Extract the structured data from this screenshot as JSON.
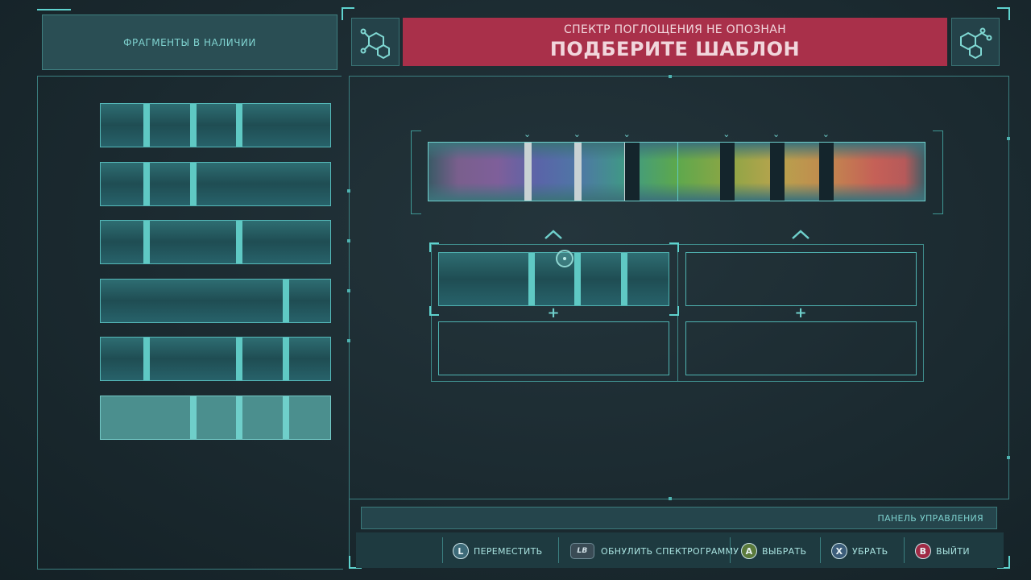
{
  "left_panel": {
    "title": "ФРАГМЕНТЫ В НАЛИЧИИ",
    "fragments": [
      {
        "bars": [
          0.2,
          0.4,
          0.6
        ],
        "selected": false
      },
      {
        "bars": [
          0.2,
          0.4
        ],
        "selected": false
      },
      {
        "bars": [
          0.2,
          0.6
        ],
        "selected": false
      },
      {
        "bars": [
          0.8
        ],
        "selected": false
      },
      {
        "bars": [
          0.2,
          0.6,
          0.8
        ],
        "selected": false
      },
      {
        "bars": [
          0.4,
          0.6,
          0.8
        ],
        "selected": true
      }
    ]
  },
  "header": {
    "status_subtitle": "СПЕКТР ПОГЛОЩЕНИЯ НЕ ОПОЗНАН",
    "status_title": "ПОДБЕРИТЕ ШАБЛОН",
    "left_icon": "molecule-icon",
    "right_icon": "molecule-icon",
    "banner_color": "#a9304a"
  },
  "spectrum": {
    "bands": [
      {
        "pos": 0.2,
        "kind": "light"
      },
      {
        "pos": 0.3,
        "kind": "light"
      },
      {
        "pos": 0.4,
        "kind": "light"
      },
      {
        "pos": 0.41,
        "kind": "dark"
      },
      {
        "pos": 0.6,
        "kind": "dark"
      },
      {
        "pos": 0.7,
        "kind": "dark"
      },
      {
        "pos": 0.8,
        "kind": "dark"
      }
    ],
    "markers": [
      0.2,
      0.3,
      0.4,
      0.6,
      0.7,
      0.8
    ]
  },
  "template": {
    "slots": [
      {
        "filled": true,
        "bars": [
          0.4,
          0.6,
          0.8
        ]
      },
      {
        "filled": false,
        "bars": []
      },
      {
        "filled": false,
        "bars": []
      },
      {
        "filled": false,
        "bars": []
      }
    ]
  },
  "control_panel": {
    "title": "ПАНЕЛЬ УПРАВЛЕНИЯ",
    "actions": [
      {
        "glyph": "L",
        "label": "ПЕРЕМЕСТИТЬ",
        "icon": "left-stick-icon",
        "color": "#3d6a78"
      },
      {
        "glyph": "LB",
        "label": "ОБНУЛИТЬ СПЕКТРОГРАММУ",
        "icon": "lb-button-icon",
        "color": "#3a4b55"
      },
      {
        "glyph": "A",
        "label": "ВЫБРАТЬ",
        "icon": "a-button-icon",
        "color": "#5b7a3c"
      },
      {
        "glyph": "X",
        "label": "УБРАТЬ",
        "icon": "x-button-icon",
        "color": "#3c5d7a"
      },
      {
        "glyph": "B",
        "label": "ВЫЙТИ",
        "icon": "b-button-icon",
        "color": "#a02a45"
      }
    ]
  }
}
